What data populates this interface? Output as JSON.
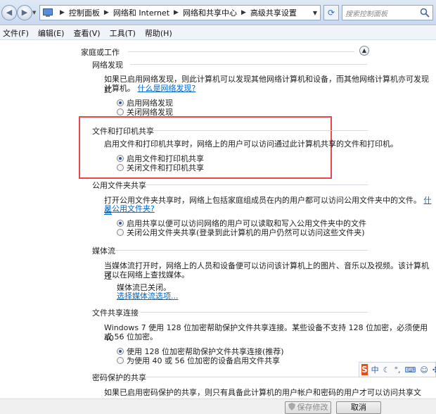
{
  "breadcrumb": {
    "items": [
      "控制面板",
      "网络和 Internet",
      "网络和共享中心",
      "高级共享设置"
    ]
  },
  "search": {
    "placeholder": "搜索控制面板"
  },
  "menu": [
    "文件(F)",
    "编辑(E)",
    "查看(V)",
    "工具(T)",
    "帮助(H)"
  ],
  "profile": {
    "title": "家庭或工作"
  },
  "sections": {
    "discovery": {
      "title": "网络发现",
      "desc": "如果已启用网络发现，则此计算机可以发现其他网络计算机和设备，而其他网络计算机亦可发现此",
      "desc2": "计算机。",
      "link": "什么是网络发现?",
      "options": [
        "启用网络发现",
        "关闭网络发现"
      ]
    },
    "fileprint": {
      "title": "文件和打印机共享",
      "desc": "启用文件和打印机共享时，网络上的用户可以访问通过此计算机共享的文件和打印机。",
      "options": [
        "启用文件和打印机共享",
        "关闭文件和打印机共享"
      ]
    },
    "public": {
      "title": "公用文件夹共享",
      "desc": "打开公用文件夹共享时，网络上包括家庭组成员在内的用户都可以访问公用文件夹中的文件。",
      "link1": "什么",
      "link2": "是公用文件夹?",
      "options": [
        "启用共享以便可以访问网络的用户可以读取和写入公用文件夹中的文件",
        "关闭公用文件夹共享(登录到此计算机的用户仍然可以访问这些文件夹)"
      ]
    },
    "media": {
      "title": "媒体流",
      "desc": "当媒体流打开时，网络上的人员和设备便可以访问该计算机上的图片、音乐以及视频。该计算机还",
      "desc2": "可以在网络上查找媒体。",
      "status": "媒体流已关闭。",
      "link": "选择媒体流选项..."
    },
    "connections": {
      "title": "文件共享连接",
      "desc": "Windows 7 使用 128 位加密帮助保护文件共享连接。某些设备不支持 128 位加密，必须使用 40",
      "desc2": "或 56 位加密。",
      "options": [
        "使用 128 位加密帮助保护文件共享连接(推荐)",
        "为使用 40 或 56 位加密的设备启用文件共享"
      ]
    },
    "password": {
      "title": "密码保护的共享",
      "desc": "如果已启用密码保护的共享，则只有具备此计算机的用户帐户和密码的用户才可以访问共享文件、"
    }
  },
  "ime": {
    "logo": "S",
    "mode": "中"
  },
  "buttons": {
    "save": "保存修改",
    "cancel": "取消"
  },
  "colors": {
    "highlight": "#e8474b",
    "link": "#0066cc"
  }
}
